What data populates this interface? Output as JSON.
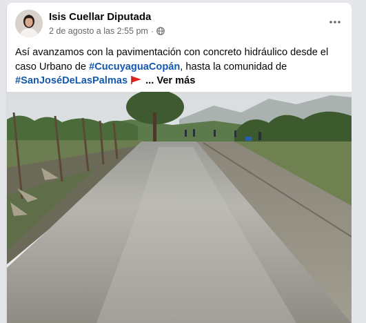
{
  "post": {
    "author": "Isis Cuellar Diputada",
    "timestamp": "2 de agosto a las 2:55 pm",
    "separator": "·",
    "privacy_icon": "globe-icon",
    "more_icon": "more-options-icon",
    "text_part1": "Así avanzamos con la pavimentación con concreto hidráulico desde el caso Urbano de ",
    "hashtag1": "#CucuyaguaCopán",
    "text_part2": ", hasta la comunidad de ",
    "hashtag2": "#SanJoséDeLasPalmas",
    "flag_icon": "red-flag-icon",
    "see_more": "... Ver más",
    "image_description_icon": "road-construction-photo"
  },
  "colors": {
    "hashtag": "#1558b0",
    "background": "#e4e6ea",
    "card": "#ffffff",
    "secondary_text": "#65676b"
  }
}
